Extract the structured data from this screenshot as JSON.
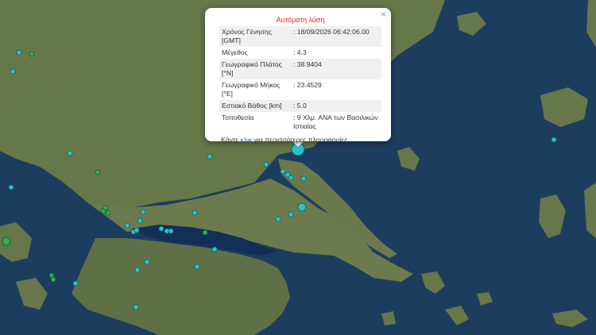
{
  "map": {
    "colors": {
      "sea": "#1b3a5c",
      "land": "#6b7a4e",
      "land_dark": "#5c6b42",
      "gulf": "#14305a",
      "marker": "#2ac4c8",
      "marker_green": "#2fae4e"
    }
  },
  "popup": {
    "title": "Αυτόματη λύση",
    "close_icon": "×",
    "rows": [
      {
        "key": "Χρόνος Γένησης [GMT]",
        "value": ": 18/09/2026 06:42:06.00"
      },
      {
        "key": "Μέγεθος",
        "value": ": 4.3"
      },
      {
        "key": "Γεωγραφικό Πλάτος [°N]",
        "value": ": 38.9404"
      },
      {
        "key": "Γεωγραφικό Μήκος [°E]",
        "value": ": 23.4529"
      },
      {
        "key": "Εστιακό Βάθος [km]",
        "value": ": 5.0"
      },
      {
        "key": "Τοποθεσία",
        "value": ": 9 Χλμ. ΑΝΑ των Βασιλικών Ιστιαίας"
      }
    ],
    "footer_pre": "Κάντε ",
    "footer_link": "κλικ",
    "footer_post": " για περισσότερες πληροφορίες"
  }
}
